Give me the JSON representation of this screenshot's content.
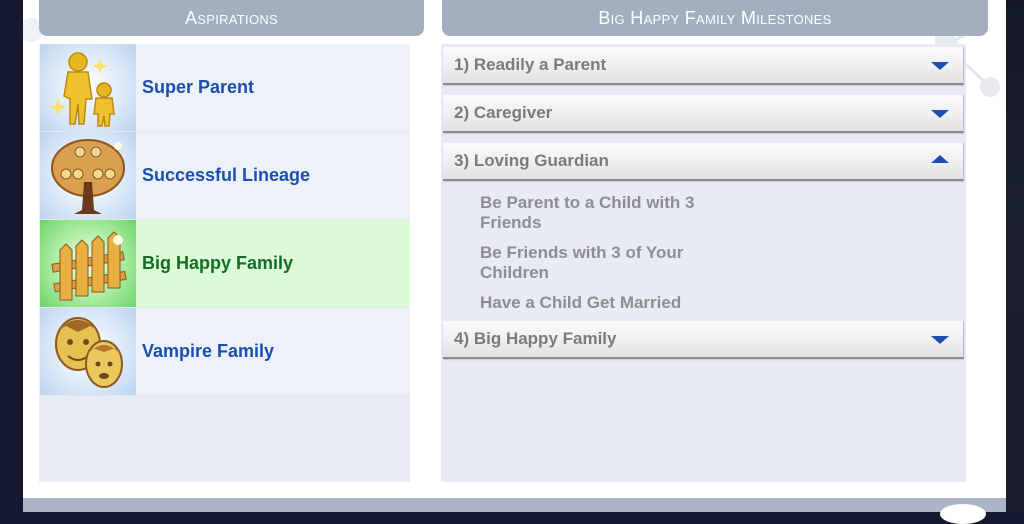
{
  "aspirations_panel": {
    "title": "Aspirations",
    "items": [
      {
        "label": "Super Parent",
        "icon": "super-parent-icon",
        "selected": false
      },
      {
        "label": "Successful Lineage",
        "icon": "family-tree-icon",
        "selected": false
      },
      {
        "label": "Big Happy Family",
        "icon": "picket-fence-icon",
        "selected": true
      },
      {
        "label": "Vampire Family",
        "icon": "vampire-faces-icon",
        "selected": false
      }
    ]
  },
  "milestones_panel": {
    "title": "Big Happy Family Milestones",
    "milestones": [
      {
        "label": "1) Readily a Parent",
        "expanded": false
      },
      {
        "label": "2) Caregiver",
        "expanded": false
      },
      {
        "label": "3) Loving Guardian",
        "expanded": true,
        "goals": [
          "Be Parent to a Child with 3 Friends",
          "Be Friends with 3 of Your Children",
          "Have a Child Get Married"
        ]
      },
      {
        "label": "4) Big Happy Family",
        "expanded": false
      }
    ]
  },
  "colors": {
    "accent_blue": "#1e4fb0",
    "selected_green_bg": "#dcfcd8",
    "selected_green_text": "#146c26",
    "header_bg": "#a3afbe"
  }
}
